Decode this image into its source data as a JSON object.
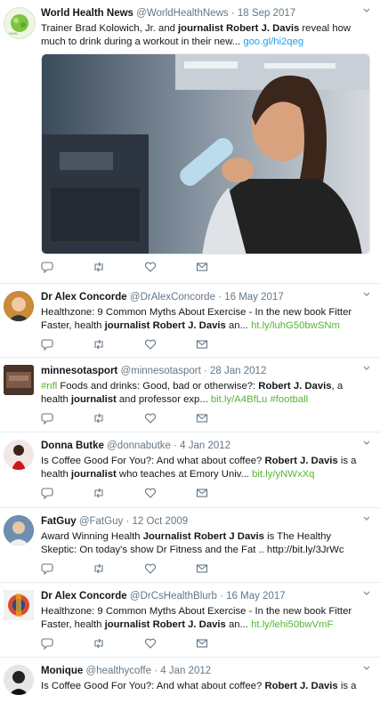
{
  "tweets": [
    {
      "name": "World Health News",
      "handle": "@WorldHealthNews",
      "date": "18 Sep 2017",
      "t1": "Trainer Brad Kolowich, Jr. and ",
      "b1": "journalist Robert J. Davis",
      "t2": " reveal how much to drink during a workout in their new... ",
      "link": "goo.gl/hi2qeg",
      "avatar_icon": "world-health-news-logo"
    },
    {
      "name": "Dr Alex Concorde",
      "handle": "@DrAlexConcorde",
      "date": "16 May 2017",
      "t1": "Healthzone: 9 Common Myths About Exercise - In the new book Fitter Faster, health ",
      "b1": "journalist Robert J. Davis",
      "t2": " an... ",
      "link": "ht.ly/luhG50bwSNm"
    },
    {
      "name": "minnesotasport",
      "handle": "@minnesotasport",
      "date": "28 Jan 2012",
      "hash1": "#nfl",
      "t1": " Foods and drinks: Good, bad or otherwise?: ",
      "b1": "Robert J. Davis",
      "t2": ", a health ",
      "b2": "journalist",
      "t3": " and professor exp... ",
      "link": "bit.ly/A4BfLu",
      "hash2": "#football"
    },
    {
      "name": "Donna Butke",
      "handle": "@donnabutke",
      "date": "4 Jan 2012",
      "t1": "Is Coffee Good For You?: And what about coffee? ",
      "b1": "Robert J. Davis",
      "t2": " is a health ",
      "b2": "journalist",
      "t3": " who teaches at Emory Univ... ",
      "link": "bit.ly/yNWxXq"
    },
    {
      "name": "FatGuy",
      "handle": "@FatGuy",
      "date": "12 Oct 2009",
      "t1": "Award Winning Health ",
      "b1": "Journalist Robert J Davis",
      "t2": " is The Healthy Skeptic: On today's show Dr Fitness and the Fat .. http://bit.ly/3JrWc"
    },
    {
      "name": "Dr Alex Concorde",
      "handle": "@DrCsHealthBlurb",
      "date": "16 May 2017",
      "t1": "Healthzone: 9 Common Myths About Exercise - In the new book Fitter Faster, health ",
      "b1": "journalist Robert J. Davis",
      "t2": " an... ",
      "link": "ht.ly/lehi50bwVmF"
    },
    {
      "name": "Monique",
      "handle": "@healthycoffe",
      "date": "4 Jan 2012",
      "t1": "Is Coffee Good For You?: And what about coffee? ",
      "b1": "Robert J. Davis",
      "t2": " is a"
    }
  ],
  "separator": "·",
  "icons": {
    "reply": "reply-icon",
    "retweet": "retweet-icon",
    "like": "like-icon",
    "dm": "mail-icon",
    "more": "chevron-down-icon"
  },
  "colors": {
    "link": "#1da1f2",
    "hashtag": "#56b435",
    "muted": "#657786",
    "divider": "#e6ecf0"
  }
}
